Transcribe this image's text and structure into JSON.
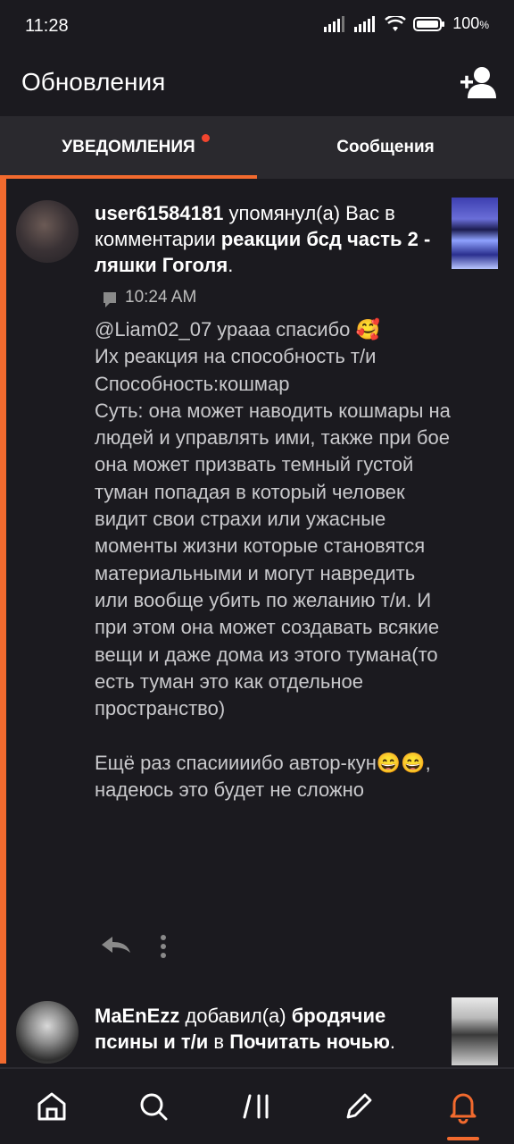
{
  "status_bar": {
    "time": "11:28",
    "battery": "100"
  },
  "header": {
    "title": "Обновления",
    "add_user_icon": "add-user-icon"
  },
  "tabs": [
    {
      "label": "УВЕДОМЛЕНИЯ",
      "active": true,
      "has_dot": true
    },
    {
      "label": "Сообщения",
      "active": false
    }
  ],
  "colors": {
    "accent": "#f26a2e",
    "background": "#1b1a1f",
    "tab_bar": "#2a292e"
  },
  "notifications": [
    {
      "user": "user61584181",
      "action": " упомянул(а) Вас в комментарии ",
      "target": "реакции бсд часть 2 - ляшки Гоголя",
      "end": ".",
      "time": "10:24 AM",
      "comment": "@Liam02_07 урааа спасибо 🥰\nИх реакция на способность т/и\nСпособность:кошмар\nСуть: она может наводить кошмары на людей и управлять ими, также при бое она может призвать темный густой туман попадая в который человек видит свои страхи или ужасные моменты жизни которые становятся материальными и могут навредить или вообще убить по желанию т/и. И при этом она может создавать всякие вещи и даже дома из этого тумана(то есть туман это как отдельное пространство)\n\nЕщё раз спасиииибо автор-кун😄😄, надеюсь это будет не сложно"
    },
    {
      "user": "MaEnEzz",
      "action": " добавил(а) ",
      "target": "бродячие псины и т/и",
      "middle": " в ",
      "target2": "Почитать ночью",
      "end": "."
    }
  ],
  "bottom_nav": [
    {
      "icon": "home-icon"
    },
    {
      "icon": "search-icon"
    },
    {
      "icon": "library-icon"
    },
    {
      "icon": "pencil-icon"
    },
    {
      "icon": "bell-icon",
      "active": true
    }
  ]
}
